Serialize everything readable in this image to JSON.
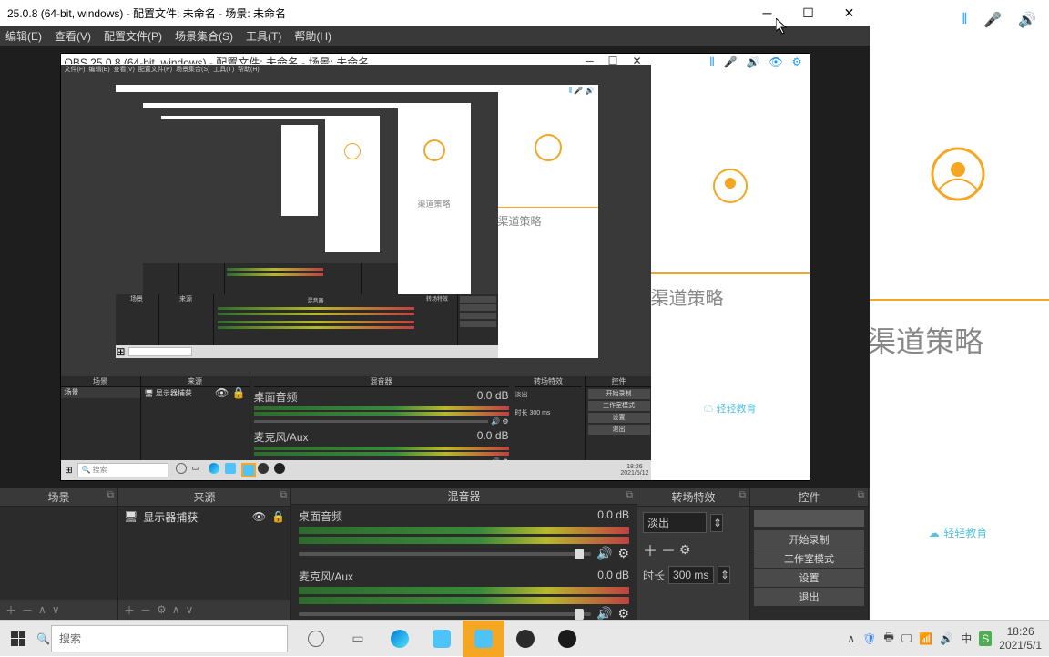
{
  "window": {
    "title": "25.0.8 (64-bit, windows) - 配置文件: 未命名 - 场景: 未命名"
  },
  "menu": {
    "edit": "编辑(E)",
    "view": "查看(V)",
    "profile": "配置文件(P)",
    "scenes": "场景集合(S)",
    "tools": "工具(T)",
    "help": "帮助(H)"
  },
  "docks": {
    "scenes": {
      "title": "场景"
    },
    "sources": {
      "title": "来源",
      "item1": "显示器捕获"
    },
    "mixer": {
      "title": "混音器",
      "ch1": {
        "name": "桌面音频",
        "level": "0.0 dB"
      },
      "ch2": {
        "name": "麦克风/Aux",
        "level": "0.0 dB"
      }
    },
    "transitions": {
      "title": "转场特效",
      "selected": "淡出",
      "duration_label": "时长",
      "duration_value": "300 ms"
    },
    "controls": {
      "title": "控件",
      "start_recording": "开始录制",
      "studio_mode": "工作室模式",
      "settings": "设置",
      "exit": "退出"
    }
  },
  "taskbar": {
    "search_placeholder": "搜索",
    "time": "18:26",
    "date": "2021/5/1"
  },
  "behind": {
    "title": "渠道策略",
    "brand": "轻轻教育"
  },
  "nested": {
    "title": "OBS 25.0.8 (64-bit, windows) - 配置文件: 未命名 - 场景: 未命名"
  }
}
